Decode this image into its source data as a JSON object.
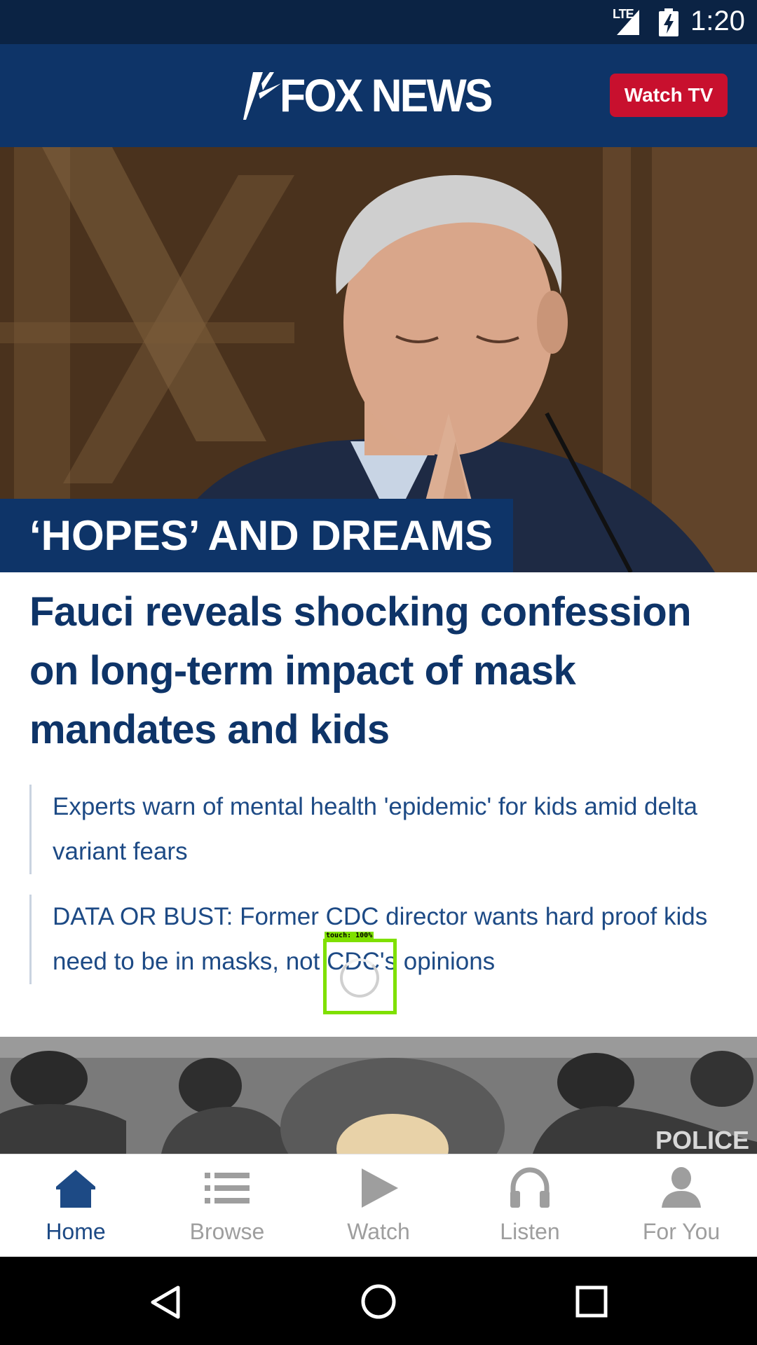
{
  "status_bar": {
    "network": "LTE",
    "time": "1:20"
  },
  "header": {
    "logo_text": "FOX NEWS",
    "watch_tv_label": "Watch TV"
  },
  "hero": {
    "kicker": "‘HOPES’ AND DREAMS",
    "headline": "Fauci reveals shocking confession on long-term impact of mask mandates and kids"
  },
  "related_links": [
    {
      "text": "Experts warn of mental health 'epidemic' for kids amid delta variant fears"
    },
    {
      "text": "DATA OR BUST: Former CDC director wants hard proof kids need to be in masks, not CDC's opinions"
    }
  ],
  "touch_indicator": {
    "label": "touch: 100%"
  },
  "story2": {
    "image_text": "POLICE"
  },
  "bottom_nav": {
    "items": [
      {
        "label": "Home",
        "icon": "home-icon",
        "active": true
      },
      {
        "label": "Browse",
        "icon": "list-icon",
        "active": false
      },
      {
        "label": "Watch",
        "icon": "play-icon",
        "active": false
      },
      {
        "label": "Listen",
        "icon": "headphones-icon",
        "active": false
      },
      {
        "label": "For You",
        "icon": "person-icon",
        "active": false
      }
    ]
  },
  "colors": {
    "brand_navy": "#0e3468",
    "status_bar": "#0b2344",
    "watch_tv_red": "#c8102e",
    "link_blue": "#1d4a85",
    "nav_inactive": "#9e9e9e"
  }
}
